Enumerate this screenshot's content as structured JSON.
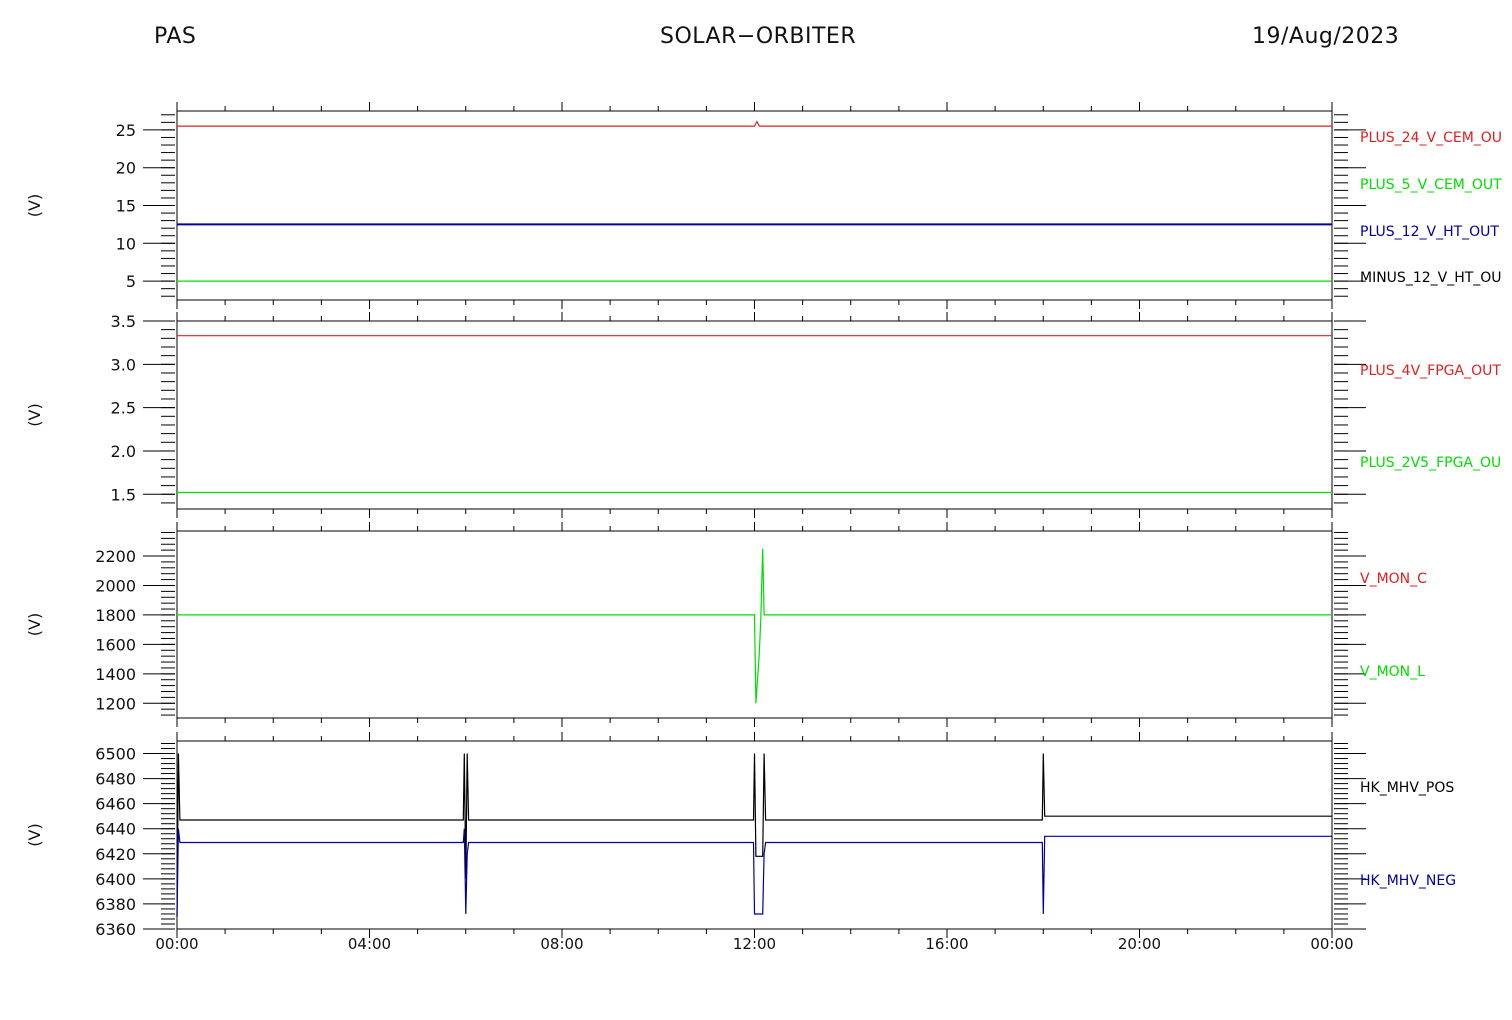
{
  "header": {
    "left": "PAS",
    "center": "SOLAR−ORBITER",
    "right": "19/Aug/2023"
  },
  "colors": {
    "red": "#e02020",
    "green": "#00dd00",
    "blue": "#0000a0",
    "black": "#000000"
  },
  "chart_data": [
    {
      "type": "line",
      "ylabel": "(V)",
      "ylim": [
        2.5,
        27.5
      ],
      "yticks": [
        5,
        10,
        15,
        20,
        25
      ],
      "ytick_labels": [
        "5",
        "10",
        "15",
        "20",
        "25"
      ],
      "x": [
        "00:00",
        "24:00"
      ],
      "series": [
        {
          "name": "PLUS_24_V_CEM_OU",
          "color": "red",
          "values": [
            25.5,
            25.5
          ],
          "blip": {
            "x": 12.05,
            "dy": 0.6
          }
        },
        {
          "name": "PLUS_5_V_CEM_OUT",
          "color": "green",
          "values": [
            5.0,
            5.0
          ]
        },
        {
          "name": "PLUS_12_V_HT_OUT",
          "color": "blue",
          "values": [
            12.5,
            12.5
          ]
        },
        {
          "name": "MINUS_12_V_HT_OU",
          "color": "black",
          "values": [
            null,
            null
          ]
        }
      ]
    },
    {
      "type": "line",
      "ylabel": "(V)",
      "ylim": [
        1.33,
        3.5
      ],
      "yticks": [
        1.5,
        2.0,
        2.5,
        3.0,
        3.5
      ],
      "ytick_labels": [
        "1.5",
        "2.0",
        "2.5",
        "3.0",
        "3.5"
      ],
      "x": [
        "00:00",
        "24:00"
      ],
      "series": [
        {
          "name": "PLUS_4V_FPGA_OUT",
          "color": "red",
          "values": [
            3.33,
            3.33
          ]
        },
        {
          "name": "PLUS_2V5_FPGA_OU",
          "color": "green",
          "values": [
            1.52,
            1.52
          ]
        }
      ]
    },
    {
      "type": "line",
      "ylabel": "(V)",
      "ylim": [
        1100,
        2370
      ],
      "yticks": [
        1200,
        1400,
        1600,
        1800,
        2000,
        2200
      ],
      "ytick_labels": [
        "1200",
        "1400",
        "1600",
        "1800",
        "2000",
        "2200"
      ],
      "x": [
        "00:00",
        "24:00"
      ],
      "series": [
        {
          "name": "V_MON_C",
          "color": "red",
          "points": []
        },
        {
          "name": "V_MON_L",
          "color": "green",
          "points": [
            [
              0,
              1800
            ],
            [
              12.0,
              1800
            ],
            [
              12.03,
              1200
            ],
            [
              12.1,
              1540
            ],
            [
              12.13,
              1770
            ],
            [
              12.17,
              2250
            ],
            [
              12.2,
              1800
            ],
            [
              24,
              1800
            ]
          ]
        }
      ]
    },
    {
      "type": "line",
      "ylabel": "(V)",
      "ylim": [
        6360,
        6510
      ],
      "yticks": [
        6360,
        6380,
        6400,
        6420,
        6440,
        6460,
        6480,
        6500
      ],
      "ytick_labels": [
        "6360",
        "6380",
        "6400",
        "6420",
        "6440",
        "6460",
        "6480",
        "6500"
      ],
      "x": [
        "00:00",
        "04:00",
        "08:00",
        "12:00",
        "16:00",
        "20:00",
        "00:00"
      ],
      "xticks_hours": [
        0,
        4,
        8,
        12,
        16,
        20,
        24
      ],
      "series": [
        {
          "name": "HK_MHV_POS",
          "color": "black",
          "points": [
            [
              0,
              6370
            ],
            [
              0.03,
              6500
            ],
            [
              0.06,
              6447
            ],
            [
              5.95,
              6447
            ],
            [
              5.97,
              6500
            ],
            [
              6.0,
              6400
            ],
            [
              6.03,
              6500
            ],
            [
              6.06,
              6447
            ],
            [
              11.98,
              6447
            ],
            [
              12.0,
              6500
            ],
            [
              12.03,
              6418
            ],
            [
              12.17,
              6418
            ],
            [
              12.2,
              6500
            ],
            [
              12.23,
              6447
            ],
            [
              17.98,
              6447
            ],
            [
              18.0,
              6500
            ],
            [
              18.03,
              6450
            ],
            [
              24,
              6450
            ]
          ]
        },
        {
          "name": "HK_MHV_NEG",
          "color": "blue",
          "points": [
            [
              0,
              6370
            ],
            [
              0.03,
              6440
            ],
            [
              0.06,
              6429
            ],
            [
              5.95,
              6429
            ],
            [
              5.97,
              6440
            ],
            [
              6.0,
              6372
            ],
            [
              6.03,
              6420
            ],
            [
              6.06,
              6429
            ],
            [
              11.98,
              6429
            ],
            [
              12.0,
              6372
            ],
            [
              12.17,
              6372
            ],
            [
              12.2,
              6420
            ],
            [
              12.23,
              6429
            ],
            [
              17.98,
              6429
            ],
            [
              18.0,
              6372
            ],
            [
              18.03,
              6434
            ],
            [
              24,
              6434
            ]
          ]
        }
      ]
    }
  ]
}
